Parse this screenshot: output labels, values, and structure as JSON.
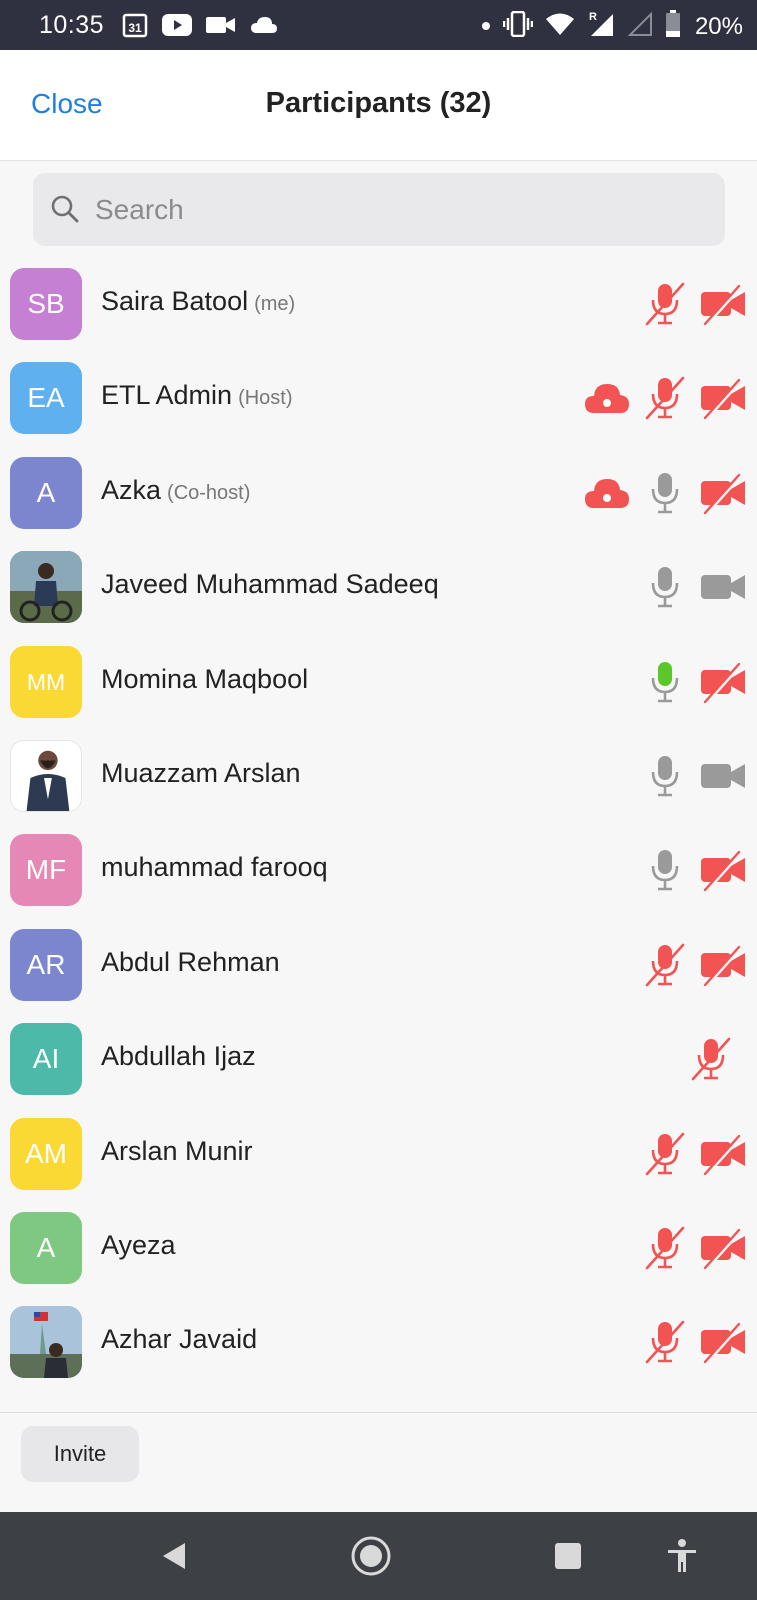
{
  "status_bar": {
    "time": "10:35",
    "calendar_day": "31",
    "battery": "20%",
    "icons_left": [
      "calendar-icon",
      "youtube-icon",
      "video-icon",
      "cloud-icon"
    ],
    "icons_right": [
      "dot-icon",
      "vibrate-icon",
      "wifi-icon",
      "signal-icon",
      "no-signal-icon",
      "battery-icon"
    ]
  },
  "header": {
    "close_label": "Close",
    "title": "Participants (32)"
  },
  "search": {
    "placeholder": "Search"
  },
  "colors": {
    "accent": "#1f7fe0",
    "muted_red": "#f25353",
    "mic_gray": "#9a9a9a",
    "mic_green": "#5cc72a"
  },
  "participants": [
    {
      "initials": "SB",
      "name": "Saira Batool",
      "tag": "(me)",
      "avatar_color": "#c57fd3",
      "cloud": false,
      "mic": "muted",
      "video": "off"
    },
    {
      "initials": "EA",
      "name": "ETL Admin",
      "tag": "(Host)",
      "avatar_color": "#5fb0ef",
      "cloud": true,
      "mic": "muted",
      "video": "off"
    },
    {
      "initials": "A",
      "name": "Azka",
      "tag": "(Co-host)",
      "avatar_color": "#7c86cf",
      "cloud": true,
      "mic": "on",
      "video": "off"
    },
    {
      "initials": "",
      "name": "Javeed Muhammad Sadeeq",
      "tag": "",
      "avatar_color": "#6d8e9e",
      "photo": true,
      "cloud": false,
      "mic": "on",
      "video": "on"
    },
    {
      "initials": "MM",
      "name": "Momina Maqbool",
      "tag": "",
      "avatar_color": "#fbd934",
      "cloud": false,
      "mic": "speaking",
      "video": "off"
    },
    {
      "initials": "",
      "name": "Muazzam Arslan",
      "tag": "",
      "avatar_color": "#ffffff",
      "photo": true,
      "cloud": false,
      "mic": "on",
      "video": "on"
    },
    {
      "initials": "MF",
      "name": "muhammad farooq",
      "tag": "",
      "avatar_color": "#e688b5",
      "cloud": false,
      "mic": "on",
      "video": "off"
    },
    {
      "initials": "AR",
      "name": "Abdul Rehman",
      "tag": "",
      "avatar_color": "#7c86cf",
      "cloud": false,
      "mic": "muted",
      "video": "off"
    },
    {
      "initials": "AI",
      "name": "Abdullah Ijaz",
      "tag": "",
      "avatar_color": "#4cb9a9",
      "cloud": false,
      "mic": "muted",
      "video": "none"
    },
    {
      "initials": "AM",
      "name": "Arslan Munir",
      "tag": "",
      "avatar_color": "#fbd934",
      "cloud": false,
      "mic": "muted",
      "video": "off"
    },
    {
      "initials": "A",
      "name": "Ayeza",
      "tag": "",
      "avatar_color": "#7fc882",
      "cloud": false,
      "mic": "muted",
      "video": "off"
    },
    {
      "initials": "",
      "name": "Azhar Javaid",
      "tag": "",
      "avatar_color": "#9fb8cf",
      "photo": true,
      "cloud": false,
      "mic": "muted",
      "video": "off"
    }
  ],
  "footer": {
    "invite_label": "Invite"
  },
  "nav_bar": {
    "icons": [
      "back-icon",
      "home-icon",
      "recents-icon",
      "accessibility-icon"
    ]
  }
}
